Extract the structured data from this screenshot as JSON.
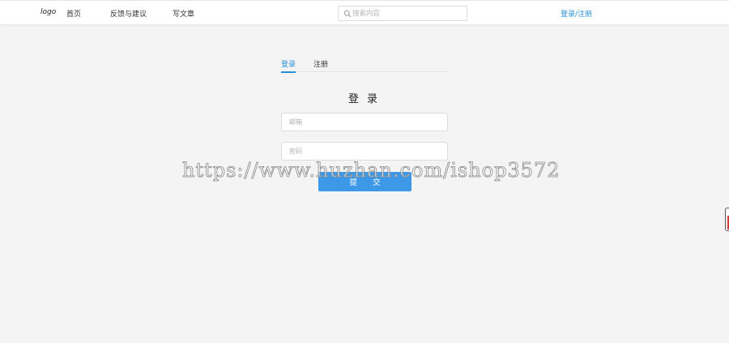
{
  "header": {
    "logo": "logo",
    "nav": [
      {
        "label": "首页"
      },
      {
        "label": "反馈与建议"
      },
      {
        "label": "写文章"
      }
    ],
    "search": {
      "placeholder": "搜索内容",
      "icon": "search-icon"
    },
    "login_link": "登录/注册"
  },
  "auth": {
    "tabs": [
      {
        "label": "登录",
        "active": true
      },
      {
        "label": "注册",
        "active": false
      }
    ],
    "title": "登 录",
    "email_placeholder": "邮箱",
    "password_placeholder": "密码",
    "submit_label": "提 交"
  },
  "watermark": "https://www.huzhan.com/ishop3572",
  "colors": {
    "accent": "#2a8fd4",
    "button": "#3d99e8",
    "background": "#f4f4f4"
  }
}
